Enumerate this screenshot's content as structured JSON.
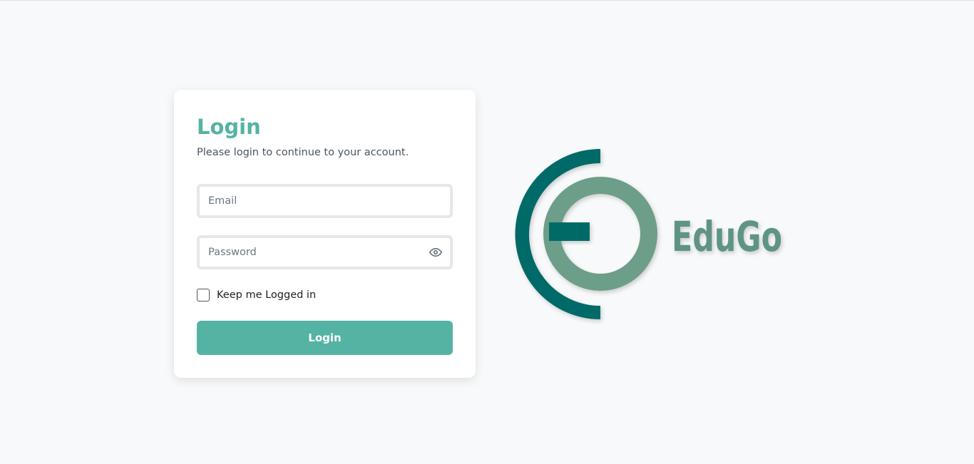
{
  "login": {
    "title": "Login",
    "subtitle": "Please login to continue to your account.",
    "email_placeholder": "Email",
    "password_placeholder": "Password",
    "password_toggle_icon": "eye-icon",
    "remember_label": "Keep me Logged in",
    "remember_checked": false,
    "button_label": "Login"
  },
  "brand": {
    "name": "EduGo",
    "colors": {
      "accent": "#54b3a3",
      "logo_dark": "#006a67",
      "logo_light": "#6d9e89",
      "text_logo": "#5f9484"
    }
  }
}
